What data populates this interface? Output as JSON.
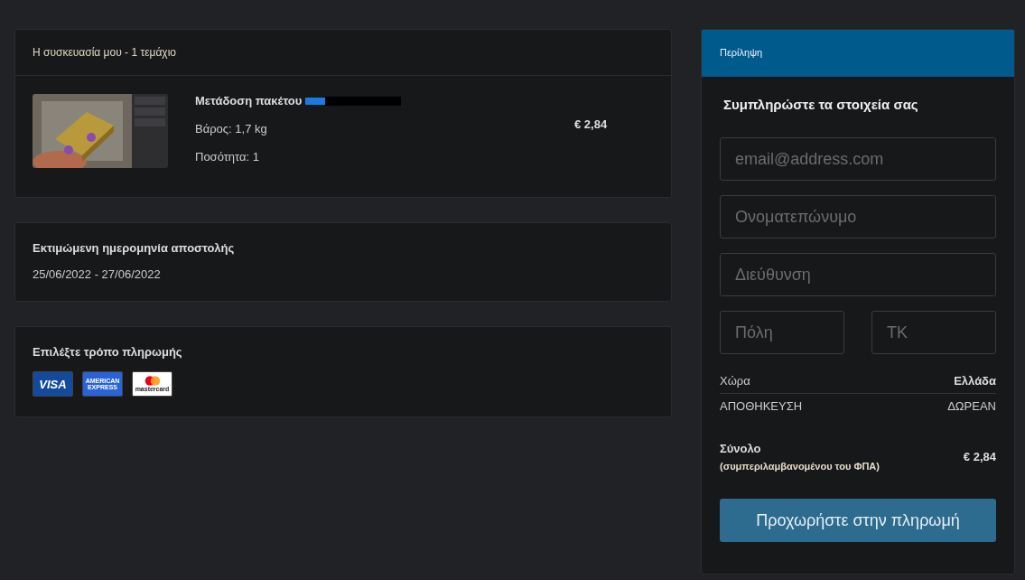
{
  "package": {
    "title": "Η συσκευασία μου - 1 τεμάχιο",
    "item": {
      "kind": "picture",
      "name": "Μετάδοση πακέτου",
      "weight": "Βάρος: 1,7 kg",
      "quantity": "Ποσότητα: 1",
      "price": "€ 2,84"
    }
  },
  "delivery": {
    "title": "Εκτιμώμενη ημερομηνία αποστολής",
    "dates": "25/06/2022 - 27/06/2022"
  },
  "payment": {
    "title": "Επιλέξτε τρόπο πληρωμής",
    "methods": [
      {
        "kind": "visa",
        "label": "VISA"
      },
      {
        "kind": "amex",
        "label": "AMERICAN EXPRESS"
      },
      {
        "kind": "mastercard",
        "label": "mastercard"
      }
    ]
  },
  "summary": {
    "header": "Περίληψη",
    "heading": "Συμπληρώστε τα στοιχεία σας",
    "fields": [
      {
        "placeholder": "email@address.com"
      },
      {
        "placeholder": "Ονοματεπώνυμο"
      },
      {
        "placeholder": "Διεύθυνση"
      }
    ],
    "split_fields": [
      {
        "placeholder": "Πόλη"
      },
      {
        "placeholder": "ΤΚ"
      }
    ],
    "country": {
      "label": "Χώρα",
      "value": "Ελλάδα"
    },
    "storage": {
      "label": "ΑΠΟΘΗΚΕΥΣΗ",
      "value": "ΔΩΡΕΑΝ"
    },
    "total": {
      "label": "Σύνολο",
      "note": "(συμπεριλαμβανομένου του ΦΠΑ)",
      "value": "€ 2,84"
    },
    "button": "Προχωρήστε στην πληρωμή"
  }
}
